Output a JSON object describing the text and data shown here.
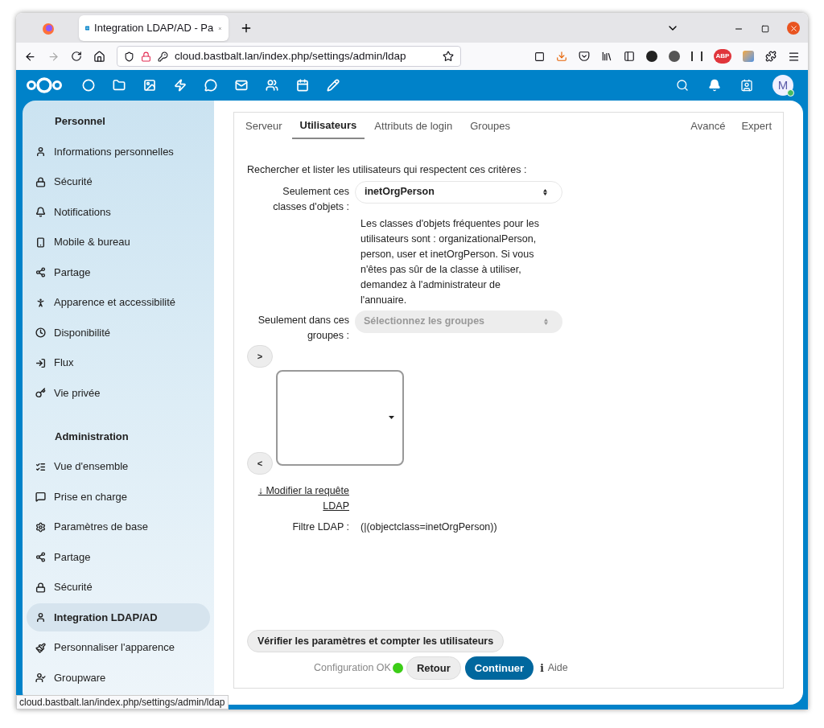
{
  "browser": {
    "tab_title": "Integration LDAP/AD - Pa",
    "url": "cloud.bastbalt.lan/index.php/settings/admin/ldap",
    "abp_badge": "ABP",
    "status_url": "cloud.bastbalt.lan/index.php/settings/admin/ldap"
  },
  "header": {
    "avatar_letter": "M"
  },
  "sidebar": [
    {
      "title": "Personnel",
      "items": [
        {
          "label": "Informations personnelles",
          "selected": false
        },
        {
          "label": "Sécurité",
          "selected": false
        },
        {
          "label": "Notifications",
          "selected": false
        },
        {
          "label": "Mobile & bureau",
          "selected": false
        },
        {
          "label": "Partage",
          "selected": false
        },
        {
          "label": "Apparence et accessibilité",
          "selected": false
        },
        {
          "label": "Disponibilité",
          "selected": false
        },
        {
          "label": "Flux",
          "selected": false
        },
        {
          "label": "Vie privée",
          "selected": false
        }
      ]
    },
    {
      "title": "Administration",
      "items": [
        {
          "label": "Vue d'ensemble",
          "selected": false
        },
        {
          "label": "Prise en charge",
          "selected": false
        },
        {
          "label": "Paramètres de base",
          "selected": false
        },
        {
          "label": "Partage",
          "selected": false
        },
        {
          "label": "Sécurité",
          "selected": false
        },
        {
          "label": "Integration LDAP/AD",
          "selected": true
        },
        {
          "label": "Personnaliser l'apparence",
          "selected": false
        },
        {
          "label": "Groupware",
          "selected": false
        }
      ]
    }
  ],
  "tabs": [
    {
      "label": "Serveur",
      "selected": false
    },
    {
      "label": "Utilisateurs",
      "selected": true
    },
    {
      "label": "Attributs de login",
      "selected": false
    },
    {
      "label": "Groupes",
      "selected": false
    }
  ],
  "tabs_right": [
    {
      "label": "Avancé",
      "selected": false
    },
    {
      "label": "Expert",
      "selected": false
    }
  ],
  "form": {
    "intro": "Rechercher et lister les utilisateurs qui respectent ces critères :",
    "object_class_label": "Seulement ces classes d'objets :",
    "object_class_value": "inetOrgPerson",
    "help": "Les classes d'objets fréquentes pour les utilisateurs sont : organizationalPerson, person, user et inetOrgPerson. Si vous n'êtes pas sûr de la classe à utiliser, demandez à l'administrateur de l'annuaire.",
    "groups_label": "Seulement dans ces groupes :",
    "groups_placeholder": "Sélectionnez les groupes",
    "add_button": ">",
    "remove_button": "<",
    "edit_query_link": "↓ Modifier la requête LDAP",
    "filter_label": "Filtre LDAP :",
    "filter_value": "(|(objectclass=inetOrgPerson))",
    "verify_button": "Vérifier les paramètres et compter les utilisateurs",
    "status": "Configuration OK",
    "status_ok": true,
    "back_button": "Retour",
    "continue_button": "Continuer",
    "help_icon": "i",
    "help_link": "Aide"
  }
}
